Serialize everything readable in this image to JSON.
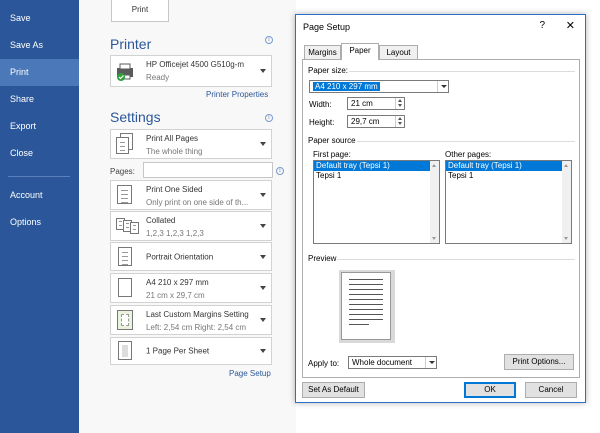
{
  "nav": {
    "items": [
      "Save",
      "Save As",
      "Print",
      "Share",
      "Export",
      "Close",
      "Account",
      "Options"
    ],
    "active": "Print",
    "color": "#2b579a"
  },
  "print_button": {
    "label": "Print"
  },
  "printer": {
    "heading": "Printer",
    "name": "HP Officejet 4500 G510g-m",
    "status": "Ready",
    "properties_link": "Printer Properties"
  },
  "settings": {
    "heading": "Settings",
    "print_all": {
      "line1": "Print All Pages",
      "line2": "The whole thing"
    },
    "pages_label": "Pages:",
    "sided": {
      "line1": "Print One Sided",
      "line2": "Only print on one side of th..."
    },
    "collated": {
      "line1": "Collated",
      "line2": "1,2,3   1,2,3   1,2,3"
    },
    "orientation": {
      "line1": "Portrait Orientation"
    },
    "paper": {
      "line1": "A4 210 x 297 mm",
      "line2": "21 cm x 29,7 cm"
    },
    "margins": {
      "line1": "Last Custom Margins Setting",
      "line2": "Left: 2,54 cm    Right: 2,54 cm"
    },
    "per_sheet": {
      "line1": "1 Page Per Sheet"
    },
    "page_setup_link": "Page Setup"
  },
  "dialog": {
    "title": "Page Setup",
    "help": "?",
    "close": "✕",
    "tabs": [
      "Margins",
      "Paper",
      "Layout"
    ],
    "active_tab": "Paper",
    "paper_size_label": "Paper size:",
    "paper_size_value": "A4 210 x 297 mm",
    "width_label": "Width:",
    "width_value": "21 cm",
    "height_label": "Height:",
    "height_value": "29,7 cm",
    "paper_source_label": "Paper source",
    "first_page_label": "First page:",
    "first_page_items": [
      "Default tray (Tepsi 1)",
      "Tepsi 1"
    ],
    "other_pages_label": "Other pages:",
    "other_pages_items": [
      "Default tray (Tepsi 1)",
      "Tepsi 1"
    ],
    "preview_label": "Preview",
    "apply_to_label": "Apply to:",
    "apply_to_value": "Whole document",
    "print_options": "Print Options...",
    "set_default": "Set As Default",
    "ok": "OK",
    "cancel": "Cancel",
    "accent": "#0078d7"
  }
}
